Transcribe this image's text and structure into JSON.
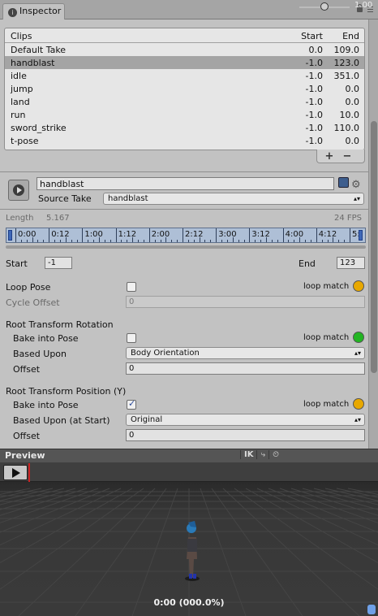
{
  "tab": {
    "title": "Inspector"
  },
  "clips": {
    "header": {
      "name": "Clips",
      "start": "Start",
      "end": "End"
    },
    "rows": [
      {
        "name": "Default Take",
        "start": "0.0",
        "end": "109.0"
      },
      {
        "name": "handblast",
        "start": "-1.0",
        "end": "123.0"
      },
      {
        "name": "idle",
        "start": "-1.0",
        "end": "351.0"
      },
      {
        "name": "jump",
        "start": "-1.0",
        "end": "0.0"
      },
      {
        "name": "land",
        "start": "-1.0",
        "end": "0.0"
      },
      {
        "name": "run",
        "start": "-1.0",
        "end": "10.0"
      },
      {
        "name": "sword_strike",
        "start": "-1.0",
        "end": "110.0"
      },
      {
        "name": "t-pose",
        "start": "-1.0",
        "end": "0.0"
      }
    ],
    "selected_index": 1,
    "add_label": "+",
    "remove_label": "−"
  },
  "clip": {
    "name": "handblast",
    "source_take_label": "Source Take",
    "source_take_value": "handblast",
    "length_label": "Length",
    "length_value": "5.167",
    "fps": "24 FPS",
    "timeline_labels": [
      "0:00",
      "0:12",
      "1:00",
      "1:12",
      "2:00",
      "2:12",
      "3:00",
      "3:12",
      "4:00",
      "4:12",
      "5:"
    ],
    "start_label": "Start",
    "start_value": "-1",
    "end_label": "End",
    "end_value": "123"
  },
  "loop": {
    "loop_pose_label": "Loop Pose",
    "loop_pose_checked": false,
    "loop_match_label": "loop match",
    "loop_match_color": "#e8a800",
    "cycle_offset_label": "Cycle Offset",
    "cycle_offset_value": "0"
  },
  "root_rotation": {
    "title": "Root Transform Rotation",
    "bake_label": "Bake into Pose",
    "bake_checked": false,
    "loop_match_label": "loop match",
    "loop_match_color": "#22b522",
    "based_upon_label": "Based Upon",
    "based_upon_value": "Body Orientation",
    "offset_label": "Offset",
    "offset_value": "0"
  },
  "root_position_y": {
    "title": "Root Transform Position (Y)",
    "bake_label": "Bake into Pose",
    "bake_checked": true,
    "loop_match_label": "loop match",
    "loop_match_color": "#e8a800",
    "based_upon_label": "Based Upon (at Start)",
    "based_upon_value": "Original",
    "offset_label": "Offset",
    "offset_value": "0"
  },
  "preview": {
    "title": "Preview",
    "ik_label": "IK",
    "speed_value": "1.00",
    "speed_fraction": 0.5,
    "time_readout": "0:00 (000.0%)"
  },
  "icons": {
    "info": "info-icon",
    "lock": "lock-icon",
    "menu": "menu-icon",
    "play": "play-icon",
    "book": "help-book-icon",
    "gear": "gear-icon",
    "pivot": "pivot-icon",
    "speed": "speed-icon"
  }
}
